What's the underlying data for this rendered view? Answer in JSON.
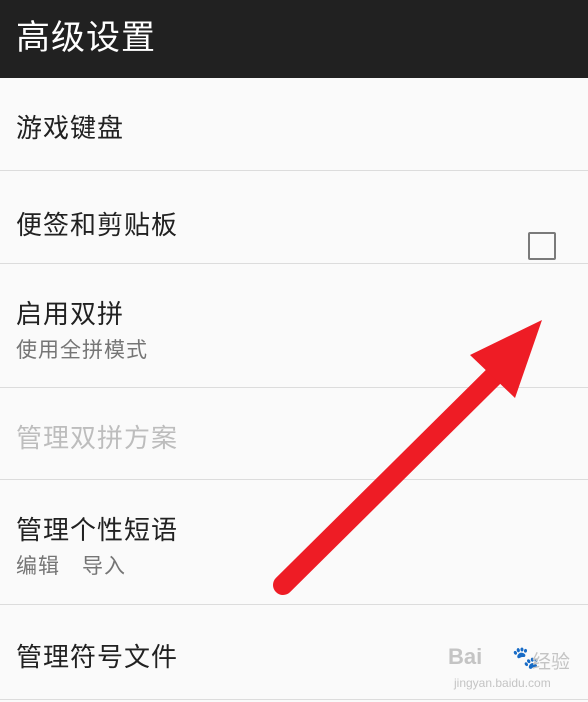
{
  "appbar": {
    "title": "高级设置"
  },
  "settings": {
    "items": [
      {
        "title": "游戏键盘"
      },
      {
        "title": "便签和剪贴板"
      },
      {
        "title": "启用双拼",
        "summary": "使用全拼模式",
        "checked": false
      },
      {
        "title": "管理双拼方案",
        "enabled": false
      },
      {
        "title": "管理个性短语",
        "summary_items": [
          "编辑",
          "导入"
        ]
      },
      {
        "title": "管理符号文件"
      }
    ]
  },
  "annotation": {
    "arrow_color": "#ee1c25",
    "target": "启用双拼 checkbox"
  },
  "watermark": {
    "brand": "Bai",
    "paw": "🐾",
    "brand_cn": "经验",
    "url": "jingyan.baidu.com"
  },
  "colors": {
    "appbar_bg": "#212121",
    "list_bg": "#fafafa",
    "divider": "#dcdcdc",
    "disabled_text": "#bdbdbd"
  }
}
